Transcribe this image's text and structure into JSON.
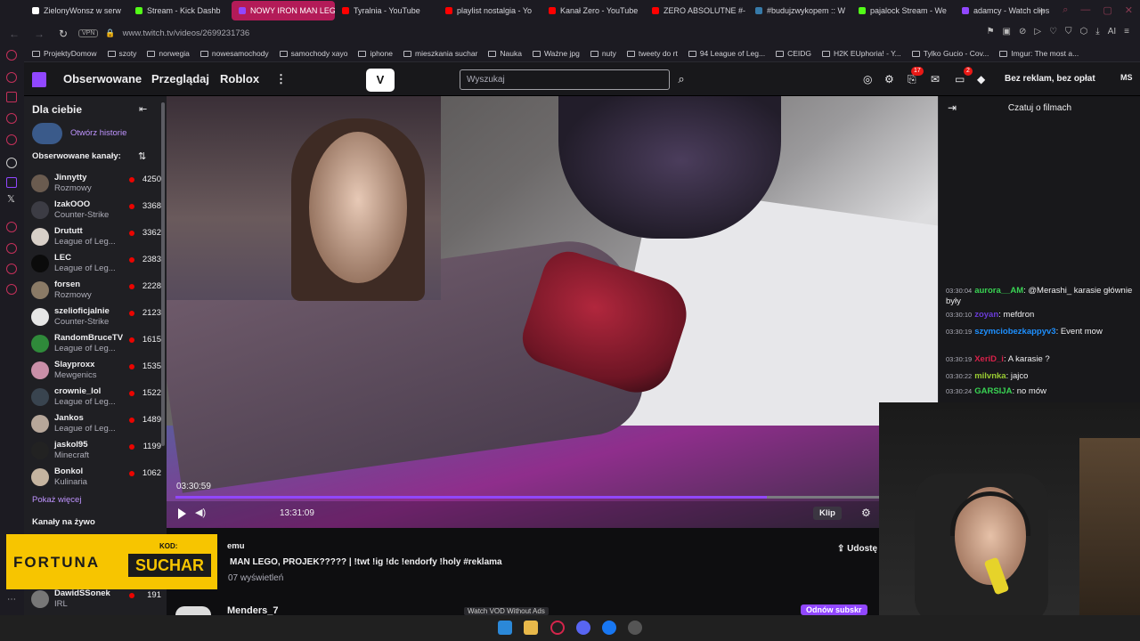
{
  "browser": {
    "tabs": [
      {
        "label": "ZielonyWonsz w serw",
        "color": "#ffffff"
      },
      {
        "label": "Stream - Kick Dashb",
        "color": "#53fc18"
      },
      {
        "label": "NOWY IRON MAN LEGO,",
        "color": "#9147ff",
        "active": true
      },
      {
        "label": "Tyralnia - YouTube",
        "color": "#ff0000"
      },
      {
        "label": "playlist nostalgia - Yo",
        "color": "#ff0000"
      },
      {
        "label": "Kanał Zero - YouTube",
        "color": "#ff0000"
      },
      {
        "label": "ZERO ABSOLUTNE #-",
        "color": "#ff0000"
      },
      {
        "label": "#budujzwykopem :: W",
        "color": "#367aa9"
      },
      {
        "label": "pajalock Stream - We",
        "color": "#53fc18"
      },
      {
        "label": "adamcy - Watch clips",
        "color": "#9147ff"
      }
    ],
    "new_tab": "+",
    "vpn": "VPN",
    "url": "www.twitch.tv/videos/2699231736",
    "bookmarks": [
      "ProjektyDomow",
      "szoty",
      "norwegia",
      "nowesamochody",
      "samochody xayo",
      "iphone",
      "mieszkania suchar",
      "Nauka",
      "Ważne jpg",
      "nuty",
      "tweety do rt",
      "94 League of Leg...",
      "CEIDG",
      "H2K EUphoria! - Y...",
      "Tylko Gucio - Cov...",
      "Imgur: The most a..."
    ]
  },
  "twitch_nav": {
    "followed": "Obserwowane",
    "browse": "Przeglądaj",
    "roblox": "Roblox",
    "more": "⋮",
    "vlogo": "V",
    "search_placeholder": "Wyszukaj",
    "notif_count": "17",
    "inbox_count": "2",
    "no_ads": "Bez reklam, bez opłat",
    "user": "MS"
  },
  "sidebar": {
    "title": "Dla ciebie",
    "history": "Otwórz historie",
    "followed_label": "Obserwowane kanały:",
    "channels": [
      {
        "name": "Jinnytty",
        "game": "Rozmowy",
        "viewers": "4250",
        "color": "#6a5b4f"
      },
      {
        "name": "IzakOOO",
        "game": "Counter-Strike",
        "viewers": "3368",
        "color": "#3c3c44"
      },
      {
        "name": "Drututt",
        "game": "League of Leg...",
        "viewers": "3362",
        "color": "#d8d0c8"
      },
      {
        "name": "LEC",
        "game": "League of Leg...",
        "viewers": "2383",
        "color": "#0b0b0b"
      },
      {
        "name": "forsen",
        "game": "Rozmowy",
        "viewers": "2228",
        "color": "#8a7a66"
      },
      {
        "name": "szelioficjalnie",
        "game": "Counter-Strike",
        "viewers": "2123",
        "color": "#e6e6e6"
      },
      {
        "name": "RandomBruceTV",
        "game": "League of Leg...",
        "viewers": "1615",
        "color": "#2f8a3a"
      },
      {
        "name": "Slayproxx",
        "game": "Mewgenics",
        "viewers": "1535",
        "color": "#c98fa8"
      },
      {
        "name": "crownie_lol",
        "game": "League of Leg...",
        "viewers": "1522",
        "color": "#39444f"
      },
      {
        "name": "Jankos",
        "game": "League of Leg...",
        "viewers": "1489",
        "color": "#b7a79a"
      },
      {
        "name": "jaskol95",
        "game": "Minecraft",
        "viewers": "1199",
        "color": "#222222"
      },
      {
        "name": "Bonkol",
        "game": "Kulinaria",
        "viewers": "1062",
        "color": "#c5b4a0"
      }
    ],
    "show_more": "Pokaż więcej",
    "live_label": "Kanały na żywo",
    "extra_channel": {
      "name": "DawidSSonek",
      "game": "IRL",
      "viewers": "191"
    }
  },
  "video": {
    "timestamp": "03:30:59",
    "duration": "13:31:09",
    "progress": 0.84,
    "clip": "Klip"
  },
  "below": {
    "channel_suffix": "emu",
    "title": "MAN LEGO, PROJEK????? | !twt !ig !dc !endorfy !holy #reklama",
    "views": "07 wyświetleń",
    "share": "Udostę",
    "next_channel": "Menders_7",
    "watch_vod": "Watch VOD Without Ads",
    "subscribe": "Odnów subskr"
  },
  "chat": {
    "title": "Czatuj o filmach",
    "messages": [
      {
        "time": "03:30:04",
        "user": "aurora__AM",
        "ucolor": "#39d353",
        "text": ": @Merashi_ karasie głównie były"
      },
      {
        "time": "03:30:10",
        "user": "zoyan",
        "ucolor": "#6a3bd8",
        "text": ": mefdron"
      },
      {
        "time": "03:30:19",
        "user": "szymciobezkappyv3",
        "ucolor": "#1e90ff",
        "text": ": Event mow"
      },
      {
        "time": "03:30:19",
        "user": "XeriD_i",
        "ucolor": "#d8214a",
        "text": ": A karasie ?"
      },
      {
        "time": "03:30:22",
        "user": "milvnka",
        "ucolor": "#9acd32",
        "text": ": jajco"
      },
      {
        "time": "03:30:24",
        "user": "GARSIJA",
        "ucolor": "#39d353",
        "text": ": no mów"
      }
    ]
  },
  "overlay": {
    "fortuna": "FORTUNA",
    "kod_label": "KOD:",
    "kod": "SUCHAR"
  },
  "colors": {
    "twitch": "#9147ff",
    "accent_tab": "#b31b58",
    "live": "#eb0400"
  }
}
